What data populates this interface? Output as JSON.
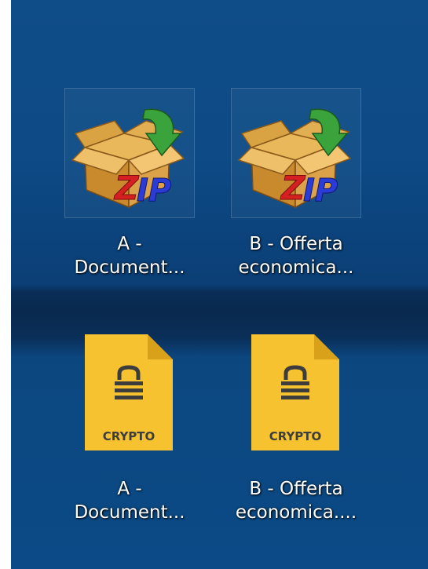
{
  "desktop": {
    "icons": [
      {
        "type": "zip-archive",
        "label_line1": "A -",
        "label_line2": "Document...",
        "badge": "ZIP"
      },
      {
        "type": "zip-archive",
        "label_line1": "B - Offerta",
        "label_line2": "economica...",
        "badge": "ZIP"
      },
      {
        "type": "crypto-file",
        "label_line1": "A -",
        "label_line2": "Document...",
        "badge": "CRYPTO"
      },
      {
        "type": "crypto-file",
        "label_line1": "B - Offerta",
        "label_line2": "economica....",
        "badge": "CRYPTO"
      }
    ]
  },
  "colors": {
    "desktop_background": "#0d4a86",
    "crypto_file": "#f7c22f",
    "box_brown": "#c98a2e",
    "arrow_green": "#3aa33c",
    "zip_blue": "#2a3bd6",
    "zip_red": "#d42020"
  }
}
